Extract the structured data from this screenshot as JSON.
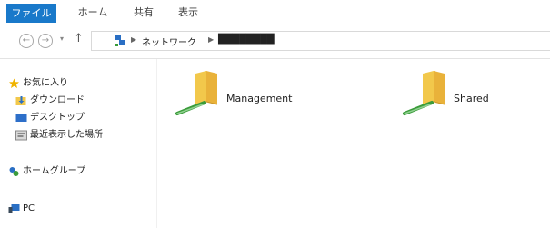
{
  "ribbon": {
    "tabs": [
      {
        "label": "ファイル"
      },
      {
        "label": "ホーム"
      },
      {
        "label": "共有"
      },
      {
        "label": "表示"
      }
    ]
  },
  "address": {
    "path": [
      "ネットワーク",
      "████████"
    ]
  },
  "nav": {
    "favorites": "お気に入り",
    "downloads": "ダウンロード",
    "desktop": "デスクトップ",
    "recent": "最近表示した場所",
    "homegroup": "ホームグループ",
    "pc": "PC"
  },
  "folders": [
    {
      "name": "Management"
    },
    {
      "name": "Shared"
    }
  ],
  "colors": {
    "file_tab": "#1979ca",
    "folder": "#f2c84b",
    "network_link": "#3a9b3a"
  }
}
